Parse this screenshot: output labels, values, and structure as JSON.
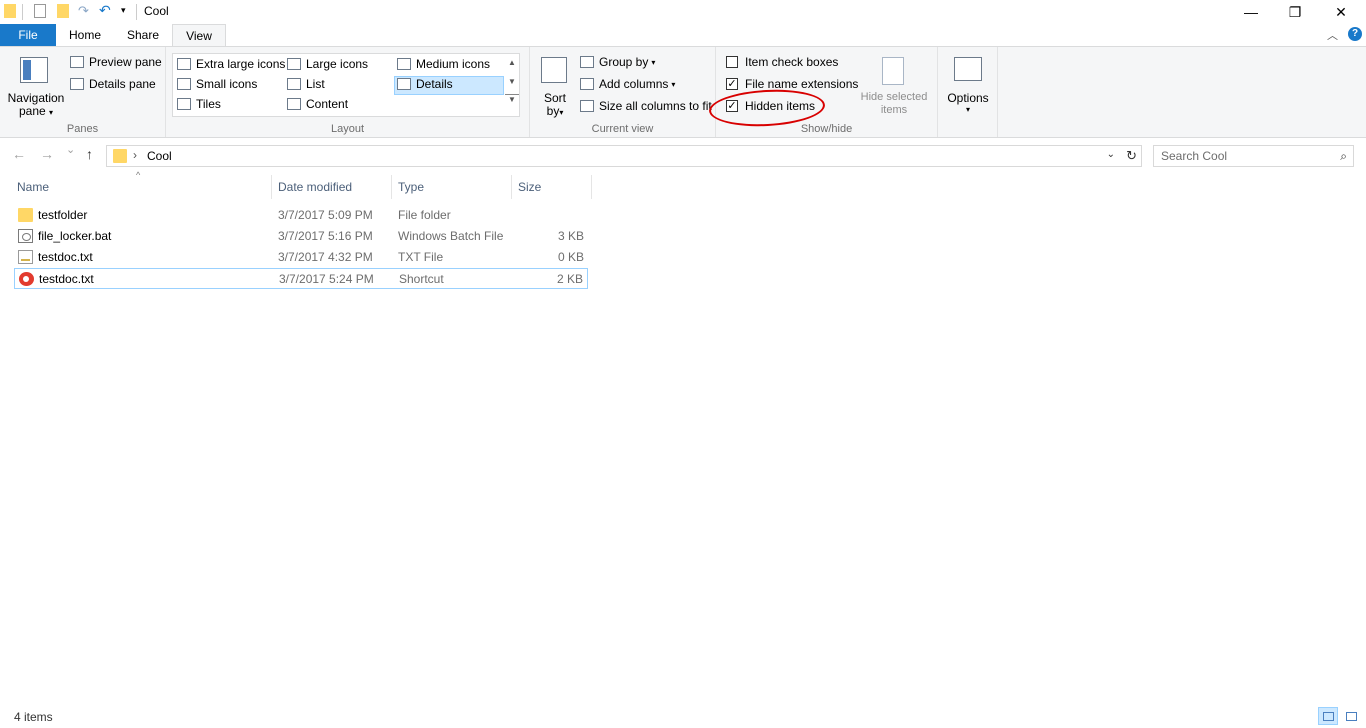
{
  "window": {
    "title": "Cool",
    "controls": {
      "minimize": "—",
      "maximize": "❐",
      "close": "✕"
    }
  },
  "tabs": [
    {
      "label": "File"
    },
    {
      "label": "Home"
    },
    {
      "label": "Share"
    },
    {
      "label": "View"
    }
  ],
  "ribbon": {
    "panes": {
      "label": "Panes",
      "navigation_pane": "Navigation",
      "navigation_pane_line2": "pane",
      "preview_pane": "Preview pane",
      "details_pane": "Details pane"
    },
    "layout": {
      "label": "Layout",
      "options": [
        {
          "label": "Extra large icons"
        },
        {
          "label": "Large icons"
        },
        {
          "label": "Medium icons"
        },
        {
          "label": "Small icons"
        },
        {
          "label": "List"
        },
        {
          "label": "Details",
          "selected": true
        },
        {
          "label": "Tiles"
        },
        {
          "label": "Content"
        }
      ]
    },
    "current_view": {
      "label": "Current view",
      "sort": "Sort",
      "sort_line2": "by",
      "group_by": "Group by",
      "add_columns": "Add columns",
      "size_all_columns": "Size all columns to fit"
    },
    "show_hide": {
      "label": "Show/hide",
      "item_check_boxes": {
        "label": "Item check boxes",
        "checked": false
      },
      "file_name_extensions": {
        "label": "File name extensions",
        "checked": true
      },
      "hidden_items": {
        "label": "Hidden items",
        "checked": true
      },
      "hide_selected": "Hide selected",
      "hide_selected_line2": "items"
    },
    "options": {
      "label": "Options"
    },
    "check_mark": "✓"
  },
  "address_bar": {
    "path": "Cool",
    "separator": "›",
    "back": "←",
    "forward": "→",
    "recent": "⌄",
    "up": "↑",
    "dropdown": "⌄",
    "refresh": "↻"
  },
  "search": {
    "placeholder": "Search Cool",
    "icon": "⌕"
  },
  "columns": [
    {
      "label": "Name"
    },
    {
      "label": "Date modified"
    },
    {
      "label": "Type"
    },
    {
      "label": "Size"
    }
  ],
  "files": [
    {
      "name": "testfolder",
      "date": "3/7/2017 5:09 PM",
      "type": "File folder",
      "size": "",
      "icon": "folder-icon"
    },
    {
      "name": "file_locker.bat",
      "date": "3/7/2017 5:16 PM",
      "type": "Windows Batch File",
      "size": "3 KB",
      "icon": "batch-file-icon"
    },
    {
      "name": "testdoc.txt",
      "date": "3/7/2017 4:32 PM",
      "type": "TXT File",
      "size": "0 KB",
      "icon": "text-file-icon"
    },
    {
      "name": "testdoc.txt",
      "date": "3/7/2017 5:24 PM",
      "type": "Shortcut",
      "size": "2 KB",
      "icon": "shortcut-icon",
      "selected": true
    }
  ],
  "status": {
    "item_count": "4 items"
  },
  "colors": {
    "accent": "#1979ca",
    "annotation": "#d80000",
    "selection": "#cce8ff"
  }
}
